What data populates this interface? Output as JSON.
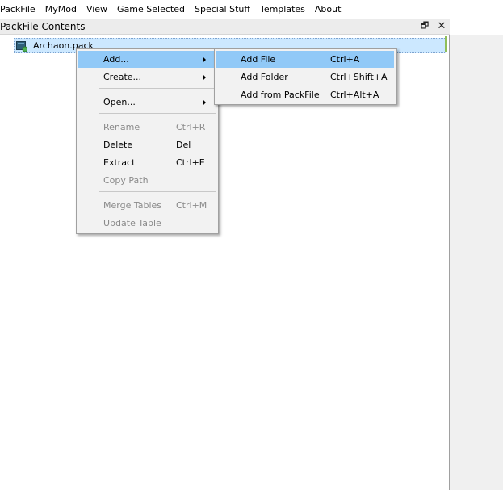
{
  "menubar": {
    "items": [
      "PackFile",
      "MyMod",
      "View",
      "Game Selected",
      "Special Stuff",
      "Templates",
      "About"
    ]
  },
  "dock": {
    "title": "PackFile Contents",
    "float_glyph": "🗗",
    "close_glyph": "✕"
  },
  "tree": {
    "root_label": "Archaon.pack",
    "root_icon": "pack-file-icon"
  },
  "context_menu": {
    "items": [
      {
        "label": "Add...",
        "shortcut": "",
        "submenu": true,
        "enabled": true
      },
      {
        "label": "Create...",
        "shortcut": "",
        "submenu": true,
        "enabled": true
      },
      {
        "label": "Open...",
        "shortcut": "",
        "submenu": true,
        "enabled": true
      },
      {
        "label": "Rename",
        "shortcut": "Ctrl+R",
        "enabled": false
      },
      {
        "label": "Delete",
        "shortcut": "Del",
        "enabled": true
      },
      {
        "label": "Extract",
        "shortcut": "Ctrl+E",
        "enabled": true
      },
      {
        "label": "Copy Path",
        "shortcut": "",
        "enabled": false
      },
      {
        "label": "Merge Tables",
        "shortcut": "Ctrl+M",
        "enabled": false
      },
      {
        "label": "Update Table",
        "shortcut": "",
        "enabled": false
      }
    ]
  },
  "submenu_add": {
    "items": [
      {
        "label": "Add File",
        "shortcut": "Ctrl+A"
      },
      {
        "label": "Add Folder",
        "shortcut": "Ctrl+Shift+A"
      },
      {
        "label": "Add from PackFile",
        "shortcut": "Ctrl+Alt+A"
      }
    ]
  },
  "colors": {
    "highlight": "#91c9f7",
    "selection": "#cce8ff",
    "menu_bg": "#f2f2f2",
    "disabled_text": "#8a8a8a"
  }
}
